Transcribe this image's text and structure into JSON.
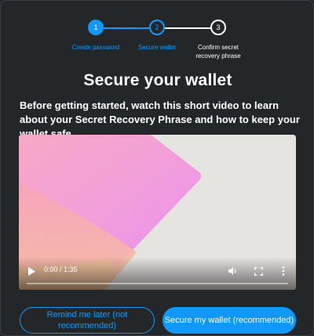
{
  "stepper": {
    "steps": [
      {
        "number": "1",
        "label": "Create password"
      },
      {
        "number": "2",
        "label": "Secure wallet"
      },
      {
        "number": "3",
        "label": "Confirm secret recovery phrase"
      }
    ],
    "active_color": "#1098fc",
    "inactive_color": "#ffffff"
  },
  "page": {
    "title": "Secure your wallet",
    "intro": "Before getting started, watch this short video to learn about your Secret Recovery Phrase and how to keep your wallet safe."
  },
  "video": {
    "time": "0:00 / 1:35",
    "progress": 0,
    "icons": [
      "play-icon",
      "volume-icon",
      "fullscreen-icon",
      "more-options-icon"
    ]
  },
  "actions": {
    "remind_later": "Remind me later (not recommended)",
    "secure_wallet": "Secure my wallet (recommended)"
  },
  "colors": {
    "background": "#24272a",
    "accent": "#1098fc"
  }
}
